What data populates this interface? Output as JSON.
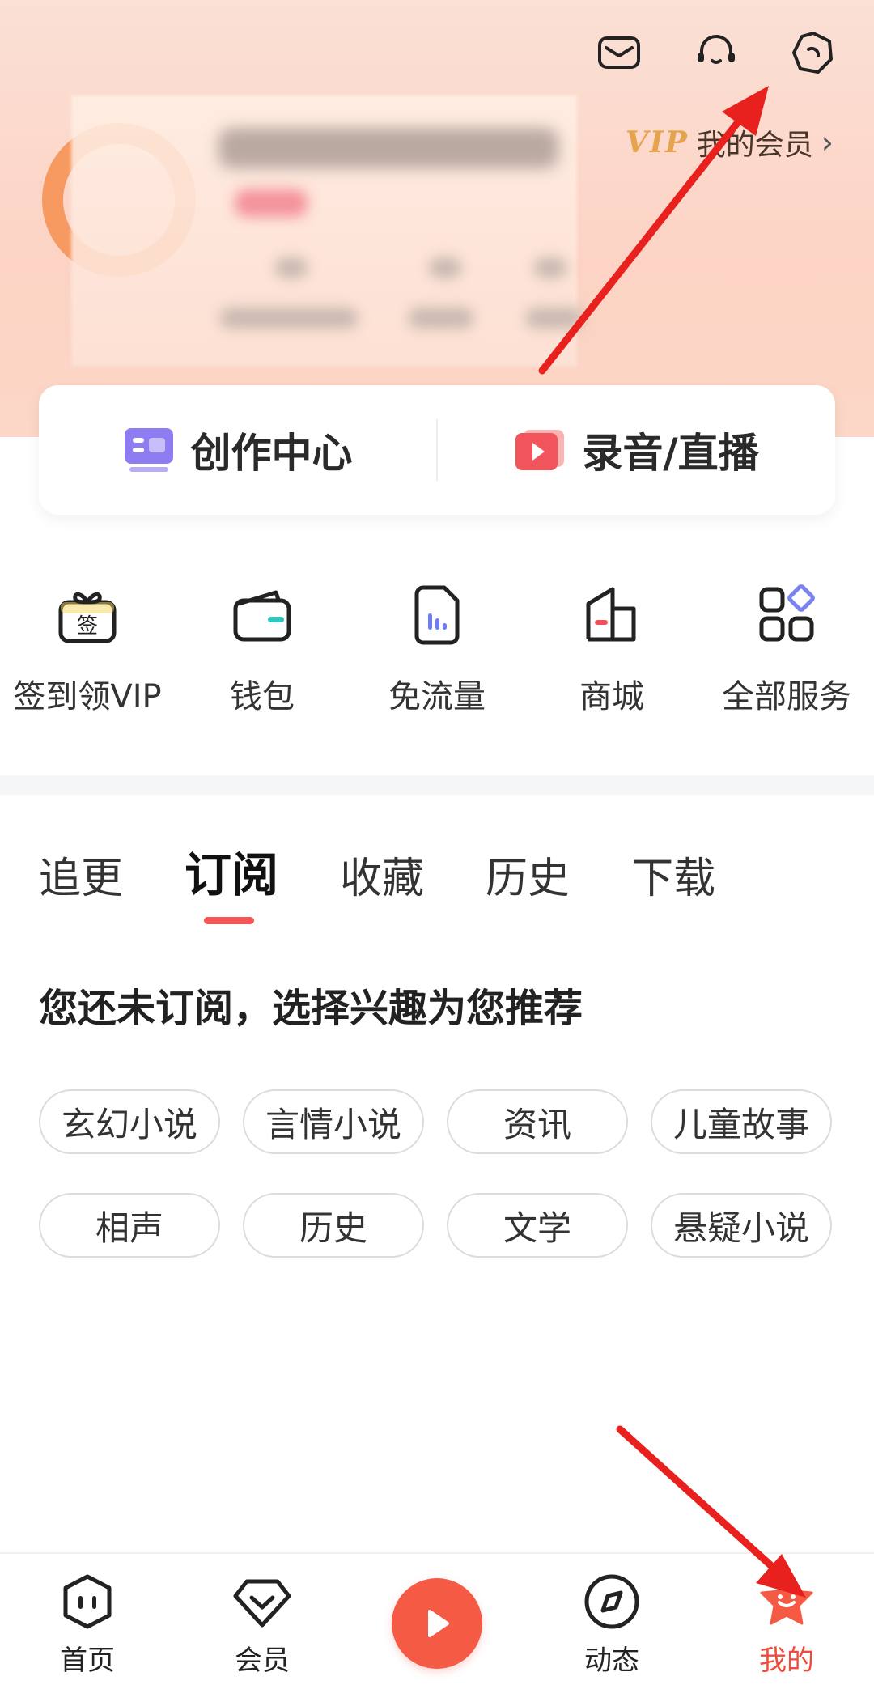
{
  "header": {
    "icons": [
      "mail-icon",
      "customer-service-icon",
      "settings-icon"
    ],
    "vip_mark": "VIP",
    "vip_link_label": "我的会员",
    "vip_chevron": "›"
  },
  "create_card": {
    "creation_center_label": "创作中心",
    "record_live_label": "录音/直播"
  },
  "quick_actions": [
    {
      "label": "签到领VIP",
      "icon": "gift-checkin-icon",
      "icon_text": "签"
    },
    {
      "label": "钱包",
      "icon": "wallet-icon"
    },
    {
      "label": "免流量",
      "icon": "free-data-icon"
    },
    {
      "label": "商城",
      "icon": "store-icon"
    },
    {
      "label": "全部服务",
      "icon": "all-services-icon"
    }
  ],
  "tabs": [
    {
      "label": "追更",
      "active": false
    },
    {
      "label": "订阅",
      "active": true
    },
    {
      "label": "收藏",
      "active": false
    },
    {
      "label": "历史",
      "active": false
    },
    {
      "label": "下载",
      "active": false
    }
  ],
  "recommend": {
    "title": "您还未订阅，选择兴趣为您推荐",
    "tags": [
      "玄幻小说",
      "言情小说",
      "资讯",
      "儿童故事",
      "相声",
      "历史",
      "文学",
      "悬疑小说"
    ]
  },
  "bottom_nav": [
    {
      "label": "首页",
      "icon": "home-icon",
      "active": false
    },
    {
      "label": "会员",
      "icon": "member-icon",
      "active": false
    },
    {
      "label": "",
      "icon": "play-icon",
      "active": false
    },
    {
      "label": "动态",
      "icon": "compass-icon",
      "active": false
    },
    {
      "label": "我的",
      "icon": "my-star-icon",
      "active": true
    }
  ],
  "colors": {
    "accent": "#f55a44",
    "active_tab_underline": "#f55555",
    "vip_gold": "#e5a34d",
    "header_bg": "#fcd6c6",
    "annotation_arrow": "#e8201e"
  }
}
